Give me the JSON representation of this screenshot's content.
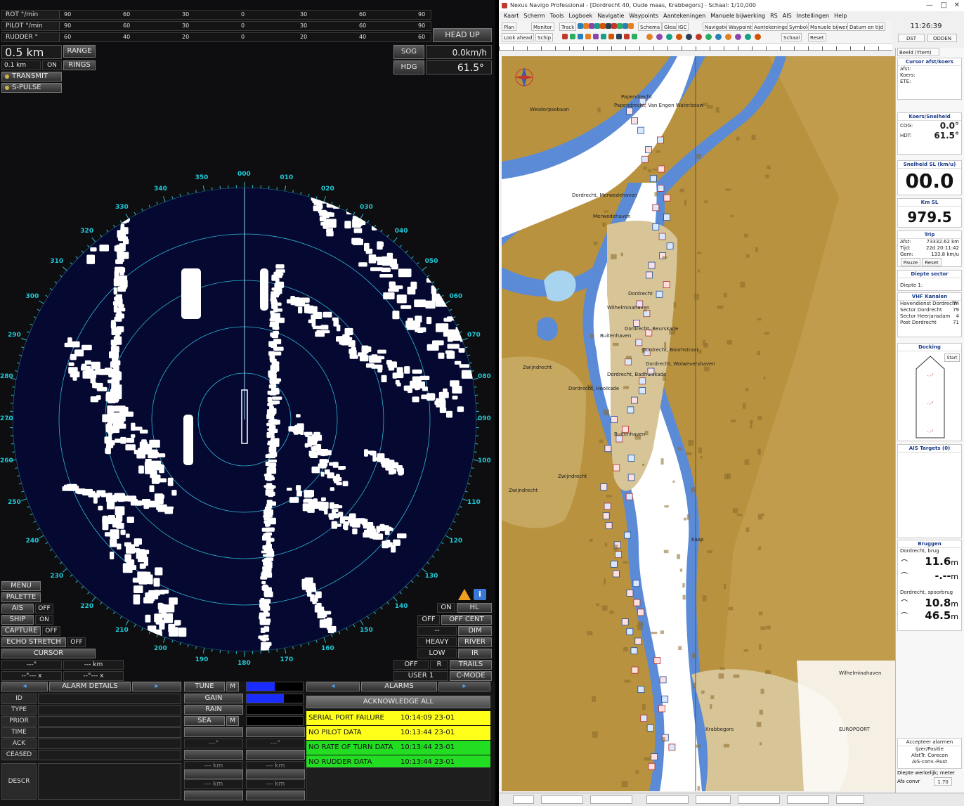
{
  "radar": {
    "rot_label": "ROT °/min",
    "pilot_label": "PILOT °/min",
    "rudder_label": "RUDDER °",
    "rot_scale": [
      "90",
      "60",
      "30",
      "0",
      "30",
      "60",
      "90"
    ],
    "pilot_scale": [
      "90",
      "60",
      "30",
      "0",
      "30",
      "60",
      "90"
    ],
    "rudder_scale": [
      "60",
      "40",
      "20",
      "0",
      "20",
      "40",
      "60"
    ],
    "head_up": "HEAD UP",
    "range_value": "0.5 km",
    "range_label": "RANGE",
    "rings_value": "0.1 km",
    "rings_on": "ON",
    "rings_label": "RINGS",
    "transmit": "TRANSMIT",
    "spulse": "S-PULSE",
    "sog_label": "SOG",
    "sog_value": "0.0km/h",
    "hdg_label": "HDG",
    "hdg_value": "61.5°",
    "compass_labels": [
      "000",
      "010",
      "020",
      "030",
      "040",
      "050",
      "060",
      "070",
      "080",
      "090",
      "100",
      "110",
      "120",
      "130",
      "140",
      "150",
      "160",
      "170",
      "180",
      "190",
      "200",
      "210",
      "220",
      "230",
      "240",
      "250",
      "260",
      "270",
      "280",
      "290",
      "300",
      "310",
      "320",
      "330",
      "340",
      "350"
    ],
    "menu": "MENU",
    "palette": "PALETTE",
    "ais": "AIS",
    "ais_state": "OFF",
    "ship": "SHIP",
    "ship_state": "ON",
    "capture": "CAPTURE",
    "capture_state": "OFF",
    "echo_stretch": "ECHO STRETCH",
    "echo_state": "OFF",
    "cursor": "CURSOR",
    "cursor_bearing": "---°",
    "cursor_range": "--- km",
    "cursor_lat": "--°--- x",
    "cursor_lon": "--°--- x",
    "right_on": "ON",
    "right_hl": "HL",
    "right_off": "OFF",
    "right_offcent": "OFF CENT",
    "right_dash": "--",
    "right_dim": "DIM",
    "right_heavy": "HEAVY",
    "right_river": "RIVER",
    "right_low": "LOW",
    "right_ir": "IR",
    "right_off2": "OFF",
    "right_r": "R",
    "right_trails": "TRAILS",
    "right_user": "USER 1",
    "right_cmode": "C-MODE",
    "alarm_details": "ALARM DETAILS",
    "alarm_rows": [
      "ID",
      "TYPE",
      "PRIOR",
      "TIME",
      "ACK",
      "CEASED"
    ],
    "descr": "DESCR",
    "tune": "TUNE",
    "tune_m": "M",
    "gain": "GAIN",
    "rain": "RAIN",
    "sea": "SEA",
    "sea_m": "M",
    "ctrl_values": [
      "---°",
      "---°",
      "--- km",
      "--- km",
      "--- km",
      "--- km"
    ],
    "alarms": "ALARMS",
    "acknowledge": "ACKNOWLEDGE ALL",
    "alarm_list": [
      {
        "text": "SERIAL PORT FAILURE",
        "time": "10:14:09 23-01",
        "color": "#ffff1a"
      },
      {
        "text": "NO PILOT DATA",
        "time": "10:13:44 23-01",
        "color": "#ffff1a"
      },
      {
        "text": "NO RATE OF TURN DATA",
        "time": "10:13:44 23-01",
        "color": "#22dd22"
      },
      {
        "text": "NO RUDDER DATA",
        "time": "10:13:44 23-01",
        "color": "#22dd22"
      }
    ]
  },
  "ecdis": {
    "title": "Nexus Navigo Professional - [Dordrecht 40, Oude maas, Krabbegors] - Schaal: 1/10,000",
    "menu": [
      "Kaart",
      "Scherm",
      "Tools",
      "Logboek",
      "Navigatie",
      "Waypoints",
      "Aantekeningen",
      "Manuele bijwerking",
      "RS",
      "AIS",
      "Instellingen",
      "Help"
    ],
    "tools_row1": [
      "Plan",
      "Monitor",
      "Track",
      "Schema",
      "Glear",
      "IGC",
      "Navigatie",
      "Waypoints",
      "Aantekeningen",
      "Symbolen",
      "Manuele bijwerking",
      "Datum en tijd"
    ],
    "tools_row2": [
      "Look ahead",
      "Schip",
      "Schaal",
      "Reset"
    ],
    "clock": "11:26:39",
    "clock_b1": "DST",
    "clock_b2": "ODDEN",
    "chart_labels": [
      "Papendrecht",
      "Papendrecht, Van Engen Waterbouw",
      "Wesdorpsebaan",
      "Dordrecht, Merwedehaven",
      "Merwedehaven",
      "Dordrecht",
      "Wilhelminahaven",
      "Buitenhaven",
      "Zwijndrecht",
      "Dordrecht, Hooikade",
      "Dordrecht, Badhuiskade",
      "Zwijndrecht",
      "Krabbegors",
      "Wilhelminahaven",
      "EUROPOORT",
      "Dordrecht, Beurskade",
      "Dordrecht, Boomstraat",
      "Dordrecht, Wolwevershaven",
      "Buitenhaven",
      "Zwijndrecht",
      "Kaap"
    ],
    "side": {
      "tab": "Beeld (Ytem)",
      "cursor_title": "Cursor afst/koers",
      "cursor_rows": [
        "afst:",
        "Koers:",
        "ETE:"
      ],
      "heading_title": "Koers/Snelheid",
      "cog_label": "COG:",
      "cog": "0.0°",
      "hdg_label": "HDT:",
      "hdg": "61.5°",
      "speed_title": "Snelheid SL (km/u)",
      "speed": "00.0",
      "km_title": "Km SL",
      "km": "979.5",
      "trip_title": "Trip",
      "trip_rows": [
        {
          "k": "Afst:",
          "v": "73332.62 km"
        },
        {
          "k": "Tijd:",
          "v": "22d 20:11:42"
        },
        {
          "k": "Gem:",
          "v": "133.8 km/u"
        }
      ],
      "trip_pause": "Pauze",
      "trip_reset": "Reset",
      "depth_title": "Diepte sector",
      "depth_row": "Diepte 1:",
      "vhf_title": "VHF Kanalen",
      "vhf": [
        {
          "k": "Havendienst Dordrecht",
          "v": "74"
        },
        {
          "k": "Sector Dordrecht",
          "v": "79"
        },
        {
          "k": "Sector Heerjansdam",
          "v": "4"
        },
        {
          "k": "Post Dordrecht",
          "v": "71"
        }
      ],
      "docking_title": "Docking",
      "docking_btn": "Start",
      "docking_vals": [
        "-.-°",
        "-.-°",
        "-.-°"
      ],
      "ais_title": "AIS Targets (0)",
      "bridges_title": "Bruggen",
      "bridge1": "Dordrecht, brug",
      "b1v1": "11.6",
      "b1v2": "-.--",
      "bridge2": "Dordrecht, spoorbrug",
      "b2v1": "10.8",
      "b2v2": "46.5",
      "unit": "m",
      "accept_title": "Accepteer alarmen",
      "accept_rows": [
        "Ijzer/Positie",
        "AfstTr. Corecon",
        "AIS-conv.-Rust"
      ],
      "depth_footer": "Diepte werkelijk; meter",
      "depth_sel": "1.70",
      "rotating_label": "Afs convr"
    }
  }
}
